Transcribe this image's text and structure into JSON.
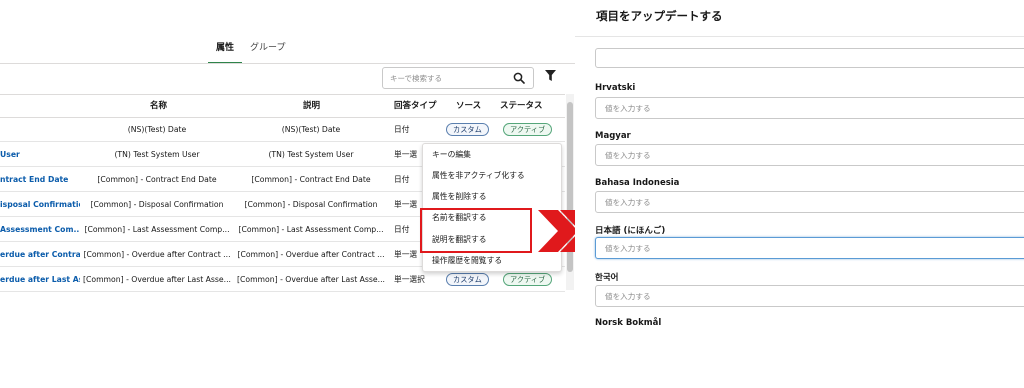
{
  "tabs": [
    {
      "label": "属性",
      "active": true
    },
    {
      "label": "グループ",
      "active": false
    }
  ],
  "search": {
    "placeholder": "キーで検索する"
  },
  "columns": {
    "label": "名称",
    "description": "説明",
    "type": "回答タイプ",
    "source": "ソース",
    "status": "ステータス"
  },
  "rows": [
    {
      "name": "",
      "label": "(NS)(Test) Date",
      "description": "(NS)(Test) Date",
      "type": "日付",
      "source": "カスタム",
      "status": "アクティブ"
    },
    {
      "name": "User",
      "label": "(TN) Test System User",
      "description": "(TN) Test System User",
      "type": "単一選",
      "source": "",
      "status": ""
    },
    {
      "name": "ntract End Date",
      "label": "[Common] - Contract End Date",
      "description": "[Common] - Contract End Date",
      "type": "日付",
      "source": "",
      "status": ""
    },
    {
      "name": "isposal Confirmation",
      "label": "[Common] - Disposal Confirmation",
      "description": "[Common] - Disposal Confirmation",
      "type": "単一選",
      "source": "",
      "status": ""
    },
    {
      "name": "Assessment Com...",
      "label": "[Common] - Last Assessment Comp...",
      "description": "[Common] - Last Assessment Comp...",
      "type": "日付",
      "source": "",
      "status": ""
    },
    {
      "name": "erdue after Contrac...",
      "label": "[Common] - Overdue after Contract ...",
      "description": "[Common] - Overdue after Contract ...",
      "type": "単一選",
      "source": "",
      "status": ""
    },
    {
      "name": "erdue after Last As...",
      "label": "[Common] - Overdue after Last Asse...",
      "description": "[Common] - Overdue after Last Asse...",
      "type": "単一選択",
      "source": "カスタム",
      "status": "アクティブ"
    }
  ],
  "menu": [
    "キーの編集",
    "属性を非アクティブ化する",
    "属性を削除する",
    "名前を翻訳する",
    "説明を翻訳する",
    "操作履歴を閲覧する"
  ],
  "panel": {
    "title": "項目をアップデートする",
    "placeholder": "値を入力する",
    "fields": [
      "Hrvatski",
      "Magyar",
      "Bahasa Indonesia",
      "日本語 (にほんご)",
      "한국어"
    ],
    "cut_label": "Norsk Bokmål"
  },
  "colors": {
    "accent_red": "#e0191c",
    "link_blue": "#0b5cab",
    "tab_green": "#2e844a"
  }
}
